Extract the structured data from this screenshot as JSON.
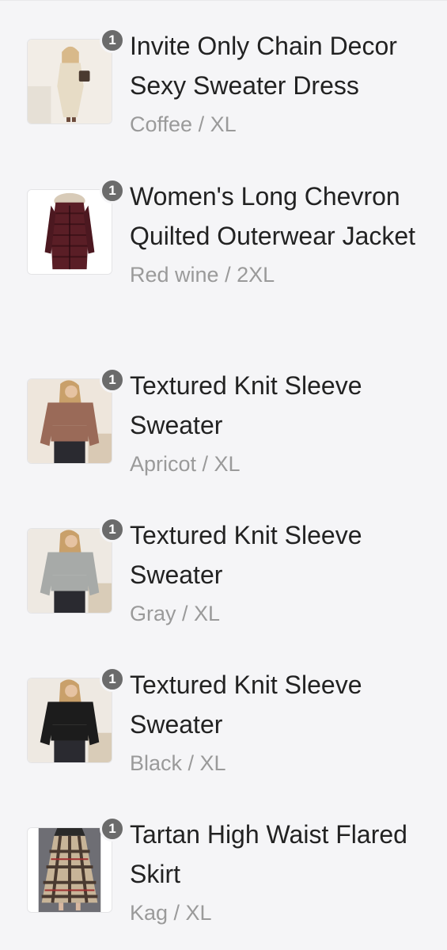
{
  "cart": {
    "items": [
      {
        "name": "Invite Only Chain Decor Sexy Sweater Dress",
        "variant": "Coffee / XL",
        "quantity": "1",
        "image": "sweater-dress-product-image",
        "color": "#d9c7a8"
      },
      {
        "name": "Women's Long Chevron Quilted Outerwear Jacket",
        "variant": "Red wine / 2XL",
        "quantity": "1",
        "image": "quilted-jacket-product-image",
        "color": "#5a1e26"
      },
      {
        "name": "Textured Knit Sleeve Sweater",
        "variant": "Apricot / XL",
        "quantity": "1",
        "image": "apricot-sweater-product-image",
        "color": "#9a6a58"
      },
      {
        "name": "Textured Knit Sleeve Sweater",
        "variant": "Gray / XL",
        "quantity": "1",
        "image": "gray-sweater-product-image",
        "color": "#a7aaa8"
      },
      {
        "name": "Textured Knit Sleeve Sweater",
        "variant": "Black / XL",
        "quantity": "1",
        "image": "black-sweater-product-image",
        "color": "#1c1c1c"
      },
      {
        "name": "Tartan High Waist Flared Skirt",
        "variant": "Kag / XL",
        "quantity": "1",
        "image": "tartan-skirt-product-image",
        "color": "#8a7560"
      }
    ]
  }
}
